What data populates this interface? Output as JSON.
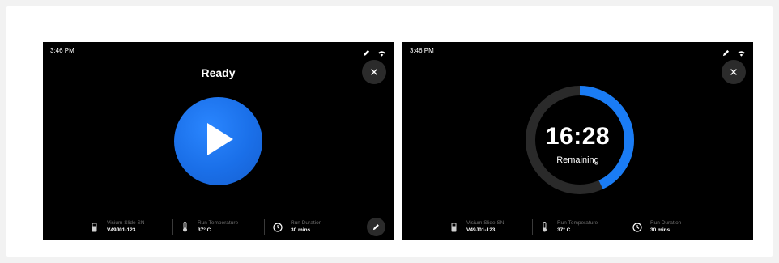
{
  "screens": {
    "ready": {
      "status_time": "3:46 PM",
      "title": "Ready",
      "footer": {
        "slide_label": "Visium Slide SN",
        "slide_value": "V49J01-123",
        "temp_label": "Run Temperature",
        "temp_value": "37° C",
        "duration_label": "Run Duration",
        "duration_value": "30 mins"
      }
    },
    "running": {
      "status_time": "3:46 PM",
      "timer": "16:28",
      "timer_caption": "Remaining",
      "progress_fraction": 0.43,
      "footer": {
        "slide_label": "Visium Slide SN",
        "slide_value": "V49J01-123",
        "temp_label": "Run Temperature",
        "temp_value": "37° C",
        "duration_label": "Run Duration",
        "duration_value": "30 mins"
      }
    }
  },
  "colors": {
    "accent": "#1a7cf5",
    "ring_track": "#2a2a2a",
    "screen_bg": "#000000"
  },
  "icons": [
    "pen-icon",
    "wifi-icon",
    "close-icon",
    "play-icon",
    "slide-icon",
    "thermometer-icon",
    "clock-icon",
    "edit-icon"
  ]
}
